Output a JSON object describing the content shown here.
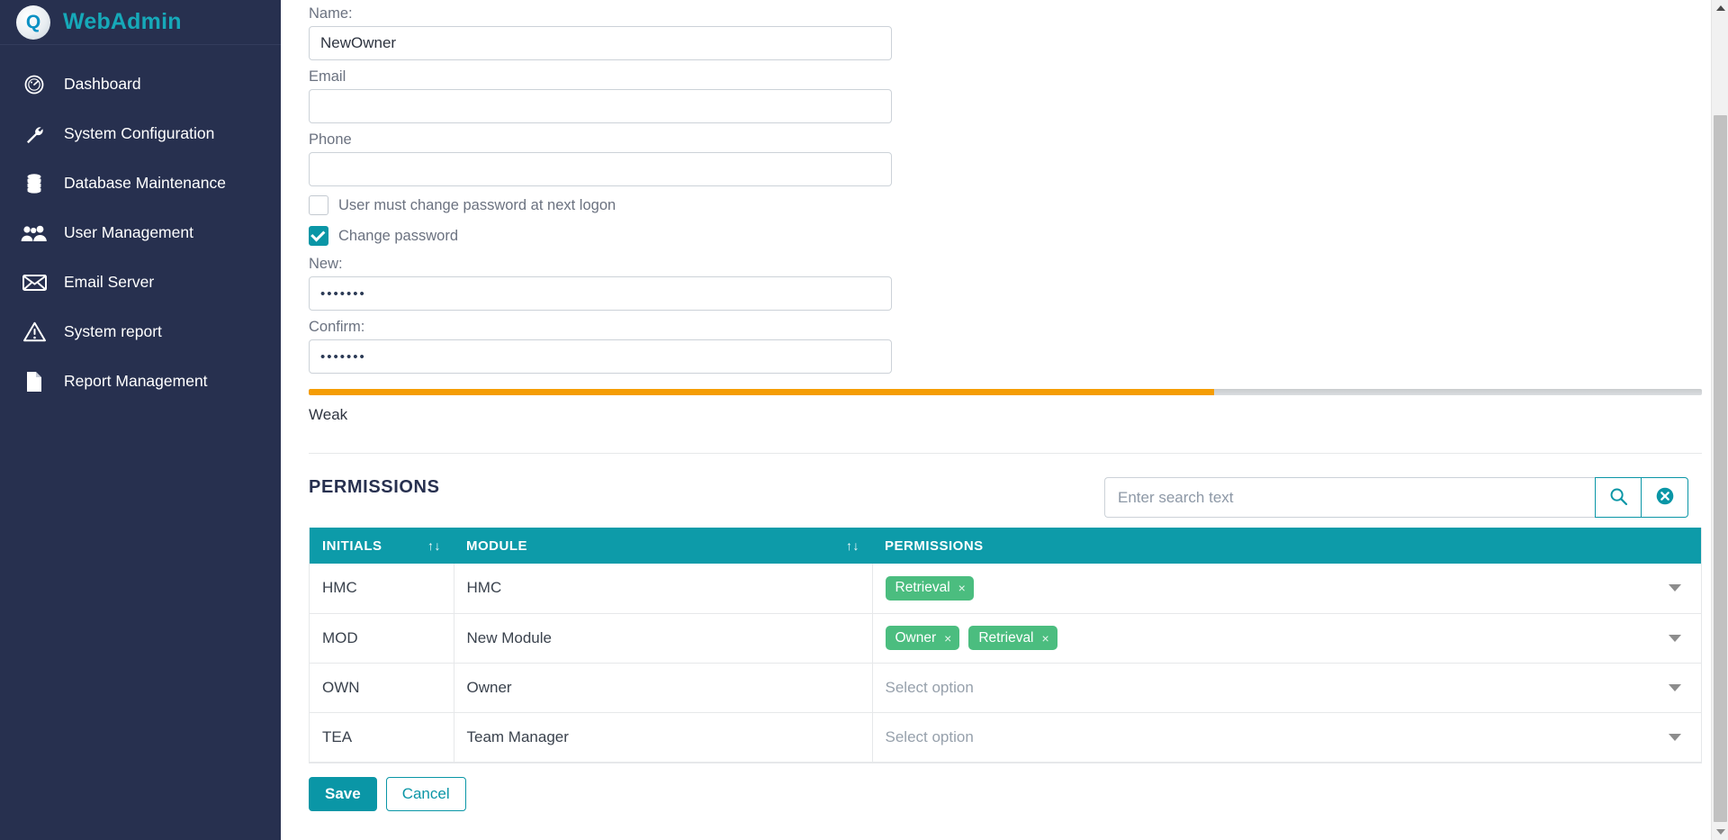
{
  "sidebar": {
    "brand": {
      "logo_letter": "Q",
      "name": "WebAdmin"
    },
    "items": [
      {
        "label": "Dashboard",
        "icon": "dashboard-icon"
      },
      {
        "label": "System Configuration",
        "icon": "wrench-icon"
      },
      {
        "label": "Database Maintenance",
        "icon": "database-icon"
      },
      {
        "label": "User Management",
        "icon": "users-icon"
      },
      {
        "label": "Email Server",
        "icon": "envelope-icon"
      },
      {
        "label": "System report",
        "icon": "warning-triangle-icon"
      },
      {
        "label": "Report Management",
        "icon": "document-icon"
      }
    ]
  },
  "form": {
    "name_label": "Name:",
    "name_value": "NewOwner",
    "email_label": "Email",
    "email_value": "",
    "email_placeholder": "",
    "phone_label": "Phone",
    "phone_value": "",
    "phone_placeholder": "",
    "must_change_label": "User must change password at next logon",
    "must_change_checked": false,
    "change_password_label": "Change password",
    "change_password_checked": true,
    "new_label": "New:",
    "new_value": "•••••••",
    "confirm_label": "Confirm:",
    "confirm_value": "•••••••",
    "strength_label": "Weak",
    "strength_percent": 65,
    "strength_color": "#f59d05",
    "strength_track_color": "#c9ccce"
  },
  "permissions": {
    "section_title": "PERMISSIONS",
    "search_placeholder": "Enter search text",
    "search_value": "",
    "search_icon": "magnifier-icon",
    "clear_icon": "clear-circle-icon",
    "columns": [
      {
        "label": "INITIALS",
        "sortable": true,
        "sort_icon": "↑↓"
      },
      {
        "label": "MODULE",
        "sortable": true,
        "sort_icon": "↑↓"
      },
      {
        "label": "PERMISSIONS",
        "sortable": false,
        "sort_icon": ""
      }
    ],
    "select_placeholder": "Select option",
    "rows": [
      {
        "initials": "HMC",
        "module": "HMC",
        "tags": [
          "Retrieval"
        ]
      },
      {
        "initials": "MOD",
        "module": "New Module",
        "tags": [
          "Owner",
          "Retrieval"
        ]
      },
      {
        "initials": "OWN",
        "module": "Owner",
        "tags": []
      },
      {
        "initials": "TEA",
        "module": "Team Manager",
        "tags": []
      }
    ],
    "tag_remove_glyph": "×",
    "tag_color": "#4bbd7f"
  },
  "footer": {
    "save_label": "Save",
    "cancel_label": "Cancel"
  },
  "theme": {
    "sidebar_bg": "#27304f",
    "accent_teal": "#0a96a6",
    "table_header": "#0d9ba9",
    "brand_color": "#16a9b9"
  }
}
